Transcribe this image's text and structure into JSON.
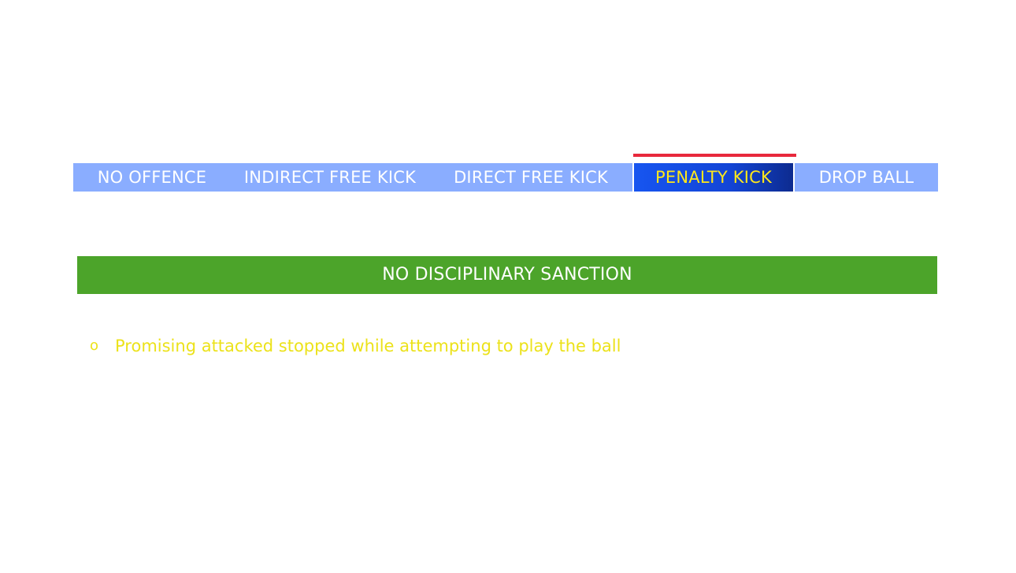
{
  "tabs": [
    {
      "label": "NO OFFENCE",
      "active": false
    },
    {
      "label": "INDIRECT FREE KICK",
      "active": false
    },
    {
      "label": "DIRECT FREE KICK",
      "active": false
    },
    {
      "label": "PENALTY KICK",
      "active": true
    },
    {
      "label": "DROP BALL",
      "active": false
    }
  ],
  "sanction": {
    "label": "NO DISCIPLINARY SANCTION",
    "color": "#4ca42a"
  },
  "bullets": [
    {
      "marker": "o",
      "text": "Promising attacked stopped while attempting to play the ball"
    }
  ],
  "colors": {
    "tab_bg": "#8aadff",
    "active_tab_bg": "#1755f0",
    "active_tab_text": "#ffe81a",
    "active_indicator": "#e8283c",
    "bullet_text": "#ece21a"
  }
}
